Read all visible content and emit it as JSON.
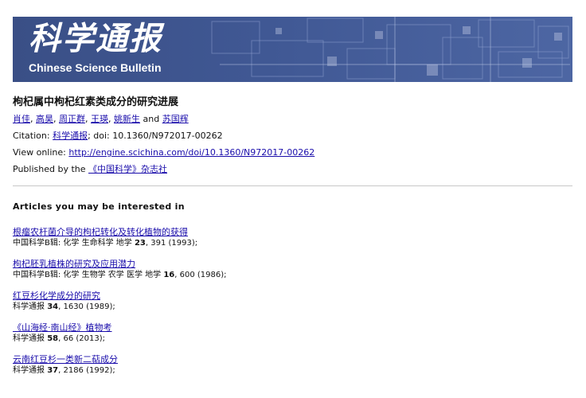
{
  "banner": {
    "logo_cn": "科学通报",
    "logo_en": "Chinese Science Bulletin"
  },
  "paper": {
    "title": "枸杞属中枸杞红素类成分的研究进展",
    "authors": [
      "肖佳",
      "高昊",
      "周正群",
      "王瑛",
      "姚新生",
      "苏国辉"
    ],
    "comma": ",",
    "and": "and",
    "citation_label": "Citation:",
    "citation_journal": "科学通报",
    "citation_doi": "; doi: 10.1360/N972017-00262",
    "view_online_label": "View online:",
    "view_online_url": "http://engine.scichina.com/doi/10.1360/N972017-00262",
    "published_label": "Published by the",
    "publisher": "《中国科学》杂志社"
  },
  "articles_heading": "Articles you may be interested in",
  "articles": [
    {
      "title": "根瘤农杆菌介导的枸杞转化及转化植物的获得",
      "source": "中国科学B辑: 化学 生命科学 地学",
      "volume": "23",
      "rest": ", 391 (1993);"
    },
    {
      "title": "枸杞胚乳植株的研究及应用潜力",
      "source": "中国科学B辑: 化学 生物学 农学 医学 地学",
      "volume": "16",
      "rest": ", 600 (1986);"
    },
    {
      "title": "红豆杉化学成分的研究",
      "source": "科学通报",
      "volume": "34",
      "rest": ", 1630 (1989);"
    },
    {
      "title": "《山海经·南山经》植物考",
      "source": "科学通报",
      "volume": "58",
      "rest": ", 66 (2013);"
    },
    {
      "title": "云南红豆杉一类新二萜成分",
      "source": "科学通报",
      "volume": "37",
      "rest": ", 2186 (1992);"
    }
  ],
  "colors": {
    "banner": "#405894",
    "link": "#1a0dab"
  }
}
